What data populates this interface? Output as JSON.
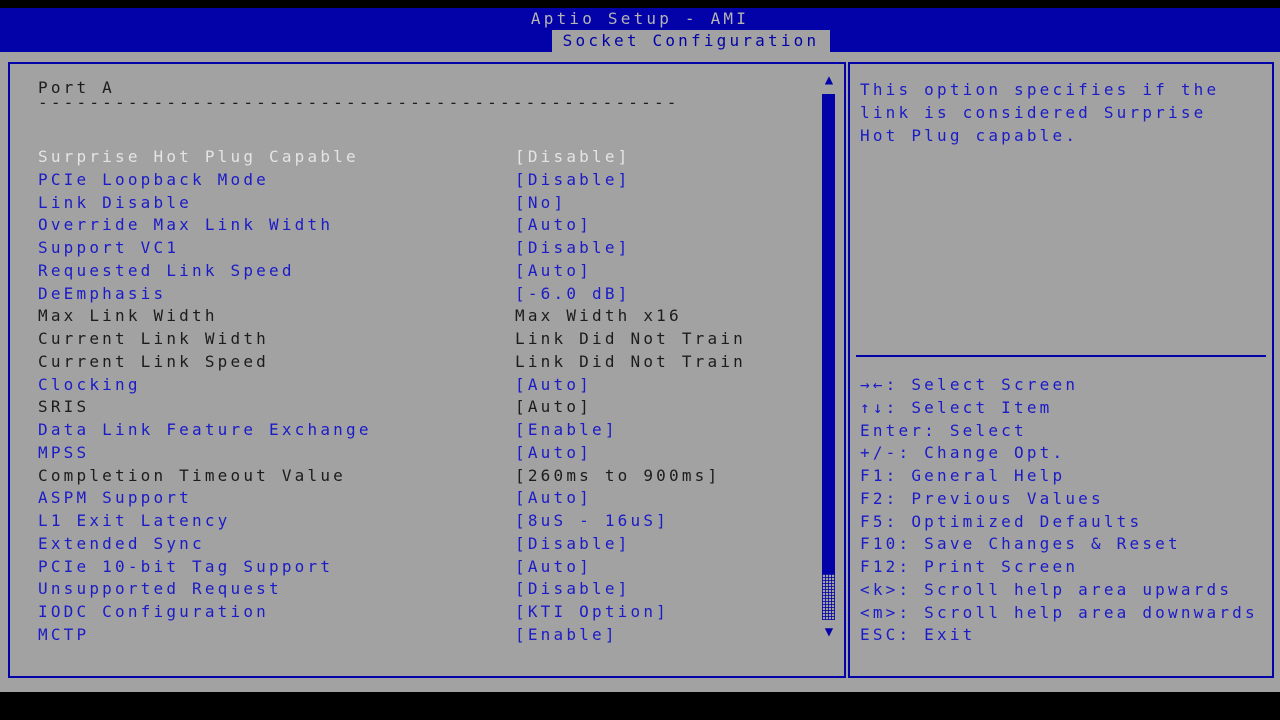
{
  "header": {
    "title": "Aptio Setup - AMI",
    "tab": "Socket Configuration"
  },
  "left_panel": {
    "section_title": "Port A",
    "separator": "--------------------------------------------------",
    "items": [
      {
        "label": "Surprise Hot Plug Capable",
        "value": "[Disable]",
        "state": "selected"
      },
      {
        "label": "PCIe Loopback Mode",
        "value": "[Disable]",
        "state": "normal"
      },
      {
        "label": "Link Disable",
        "value": "[No]",
        "state": "normal"
      },
      {
        "label": "Override Max Link Width",
        "value": "[Auto]",
        "state": "normal"
      },
      {
        "label": "Support VC1",
        "value": "[Disable]",
        "state": "normal"
      },
      {
        "label": "Requested Link Speed",
        "value": "[Auto]",
        "state": "normal"
      },
      {
        "label": "DeEmphasis",
        "value": "[-6.0 dB]",
        "state": "normal"
      },
      {
        "label": "Max Link Width",
        "value": "Max Width x16",
        "state": "readonly"
      },
      {
        "label": "Current Link Width",
        "value": "Link Did Not Train",
        "state": "readonly"
      },
      {
        "label": "Current Link Speed",
        "value": "Link Did Not Train",
        "state": "readonly"
      },
      {
        "label": "Clocking",
        "value": "[Auto]",
        "state": "normal"
      },
      {
        "label": "SRIS",
        "value": "[Auto]",
        "state": "readonly"
      },
      {
        "label": "Data Link Feature Exchange",
        "value": "[Enable]",
        "state": "normal"
      },
      {
        "label": "MPSS",
        "value": "[Auto]",
        "state": "normal"
      },
      {
        "label": "Completion Timeout Value",
        "value": "[260ms to 900ms]",
        "state": "readonly"
      },
      {
        "label": "ASPM Support",
        "value": "[Auto]",
        "state": "normal"
      },
      {
        "label": "L1 Exit Latency",
        "value": "[8uS - 16uS]",
        "state": "normal"
      },
      {
        "label": "Extended Sync",
        "value": "[Disable]",
        "state": "normal"
      },
      {
        "label": "PCIe 10-bit Tag Support",
        "value": "[Auto]",
        "state": "normal"
      },
      {
        "label": "Unsupported Request",
        "value": "[Disable]",
        "state": "normal"
      },
      {
        "label": "IODC Configuration",
        "value": "[KTI Option]",
        "state": "normal"
      },
      {
        "label": "MCTP",
        "value": "[Enable]",
        "state": "normal"
      }
    ],
    "scrollbar": {
      "up_icon": "▲",
      "down_icon": "▼"
    }
  },
  "right_panel": {
    "help_lines": [
      "This option specifies if the",
      "link is considered Surprise",
      "Hot Plug capable."
    ],
    "keys": [
      {
        "key": "→←",
        "action": "Select Screen"
      },
      {
        "key": "↑↓",
        "action": "Select Item"
      },
      {
        "key": "Enter",
        "action": "Select"
      },
      {
        "key": "+/-",
        "action": "Change Opt."
      },
      {
        "key": "F1",
        "action": "General Help"
      },
      {
        "key": "F2",
        "action": "Previous Values"
      },
      {
        "key": "F5",
        "action": "Optimized Defaults"
      },
      {
        "key": "F10",
        "action": "Save Changes & Reset"
      },
      {
        "key": "F12",
        "action": "Print Screen"
      },
      {
        "key": "<k>",
        "action": "Scroll help area upwards"
      },
      {
        "key": "<m>",
        "action": "Scroll help area downwards"
      },
      {
        "key": "ESC",
        "action": "Exit"
      }
    ]
  },
  "colors": {
    "accent_blue": "#0202A8",
    "item_blue": "#1B1BC8",
    "selected_text": "#E4E4E4",
    "readonly_text": "#1C1C1C",
    "panel_gray": "#A2A2A2",
    "black": "#000000"
  }
}
